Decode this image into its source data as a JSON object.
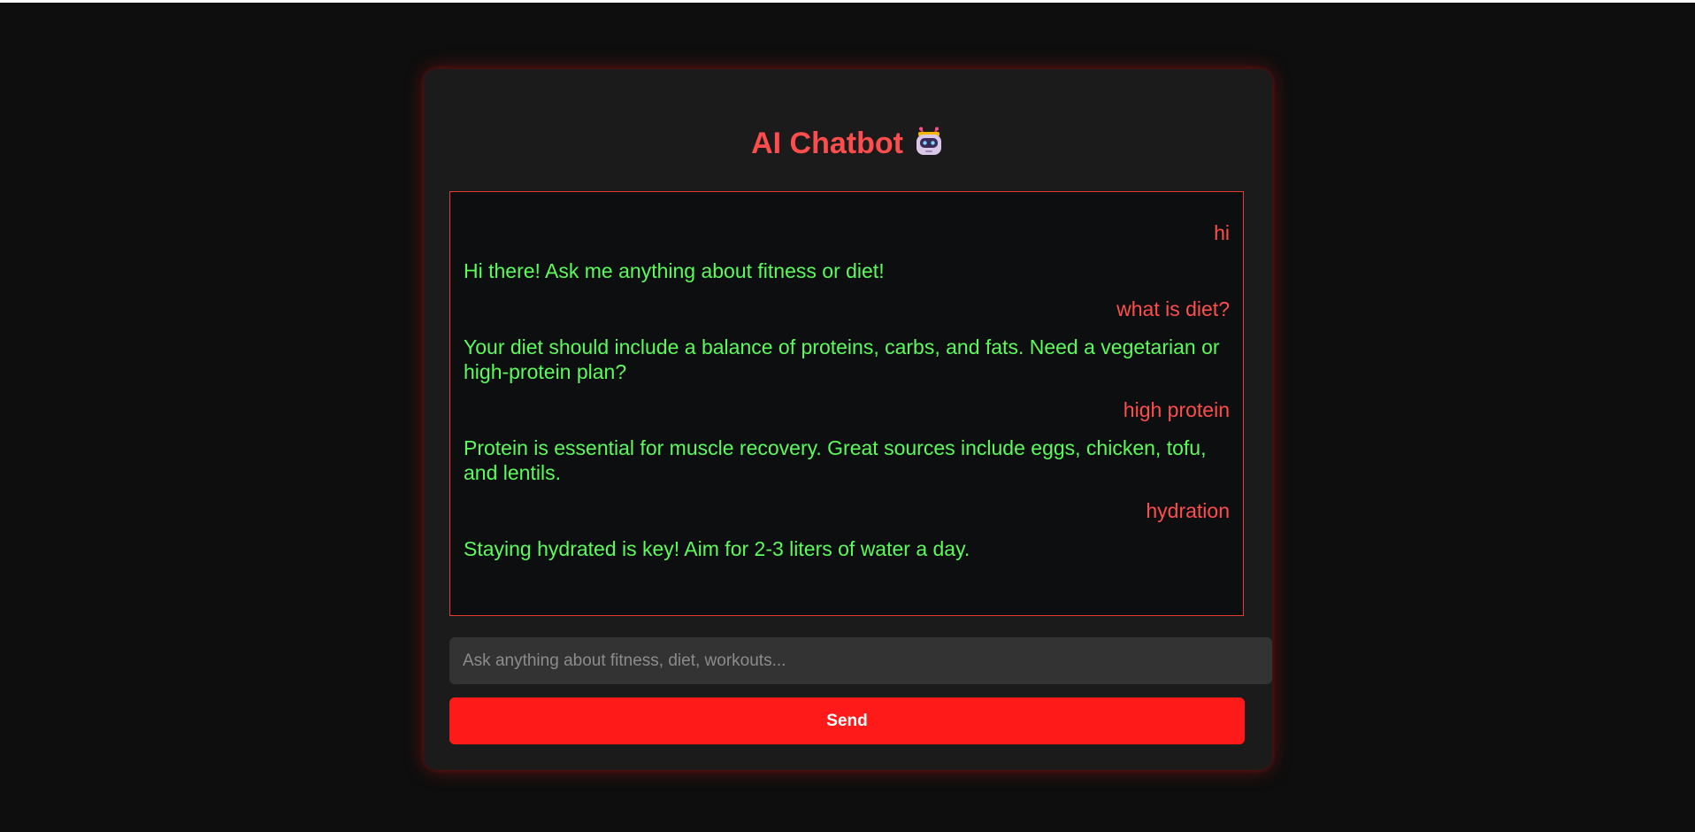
{
  "header": {
    "title": "AI Chatbot",
    "icon": "robot-icon"
  },
  "chat": {
    "messages": [
      {
        "sender": "user",
        "text": "hi"
      },
      {
        "sender": "bot",
        "text": "Hi there! Ask me anything about fitness or diet!"
      },
      {
        "sender": "user",
        "text": "what is diet?"
      },
      {
        "sender": "bot",
        "text": "Your diet should include a balance of proteins, carbs, and fats. Need a vegetarian or high-protein plan?"
      },
      {
        "sender": "user",
        "text": "high protein"
      },
      {
        "sender": "bot",
        "text": "Protein is essential for muscle recovery. Great sources include eggs, chicken, tofu, and lentils."
      },
      {
        "sender": "user",
        "text": "hydration"
      },
      {
        "sender": "bot",
        "text": "Staying hydrated is key! Aim for 2-3 liters of water a day."
      }
    ]
  },
  "input": {
    "placeholder": "Ask anything about fitness, diet, workouts...",
    "value": ""
  },
  "send_button": {
    "label": "Send"
  },
  "colors": {
    "page_background": "#0e0e0e",
    "card_background": "#1b1b1b",
    "accent_red": "#ff1a1a",
    "user_text": "#ff4d4d",
    "bot_text": "#5dfa5d",
    "chat_border": "#e53935"
  }
}
